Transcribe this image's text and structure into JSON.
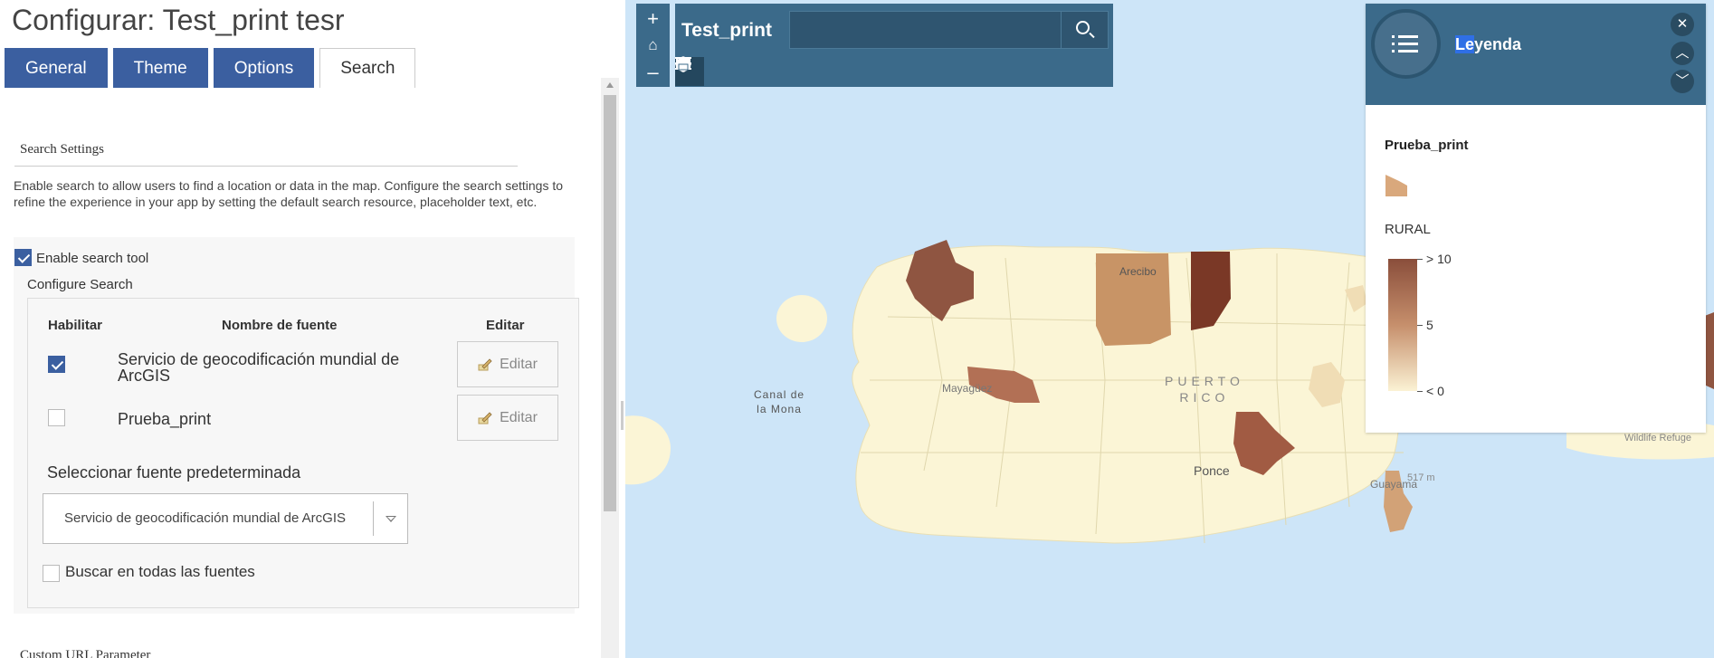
{
  "config": {
    "title": "Configurar: Test_print tesr",
    "tabs": [
      "General",
      "Theme",
      "Options",
      "Search"
    ],
    "active_tab": "Search",
    "section_title": "Search Settings",
    "description": "Enable search to allow users to find a location or data in the map. Configure the search settings to refine the experience in your app by setting the default search resource, placeholder text, etc.",
    "enable_search_label": "Enable search tool",
    "enable_search_checked": true,
    "configure_search_label": "Configure Search",
    "columns": [
      "Habilitar",
      "Nombre de fuente",
      "Editar"
    ],
    "sources": [
      {
        "name": "Servicio de geocodificación mundial de ArcGIS",
        "enabled": true,
        "edit_label": "Editar"
      },
      {
        "name": "Prueba_print",
        "enabled": false,
        "edit_label": "Editar"
      }
    ],
    "default_source_label": "Seleccionar fuente predeterminada",
    "default_source_value": "Servicio de geocodificación mundial de ArcGIS",
    "search_all_label": "Buscar en todas las fuentes",
    "search_all_checked": false,
    "custom_url_label": "Custom URL Parameter"
  },
  "map": {
    "zoom_in": "+",
    "home": "⌂",
    "zoom_out": "–",
    "app_title": "Test_print",
    "search_placeholder": "",
    "tools": [
      "legend-icon",
      "layers-icon",
      "basemap-gallery-icon",
      "info-icon",
      "share-icon",
      "print-icon"
    ],
    "labels": {
      "canal": "Canal de\nla Mona",
      "arecibo": "Arecibo",
      "mayaguez": "Mayagüez",
      "puerto_rico": "PUERTO\nRICO",
      "ponce": "Ponce",
      "guayama": "Guayama",
      "elev": "517 m",
      "wildlife": "Wildlife Refuge"
    },
    "colors": {
      "water": "#cde5f8",
      "land": "#fbf5d6",
      "header": "#3b6a8a"
    }
  },
  "legend": {
    "title_hl": "Le",
    "title_rest": "yenda",
    "layer_name": "Prueba_print",
    "field": "RURAL",
    "ramp_labels": [
      "> 10",
      "5",
      "< 0"
    ],
    "ramp_colors": [
      "#8a4e3b",
      "#c68f6c",
      "#fbf2d4"
    ]
  }
}
